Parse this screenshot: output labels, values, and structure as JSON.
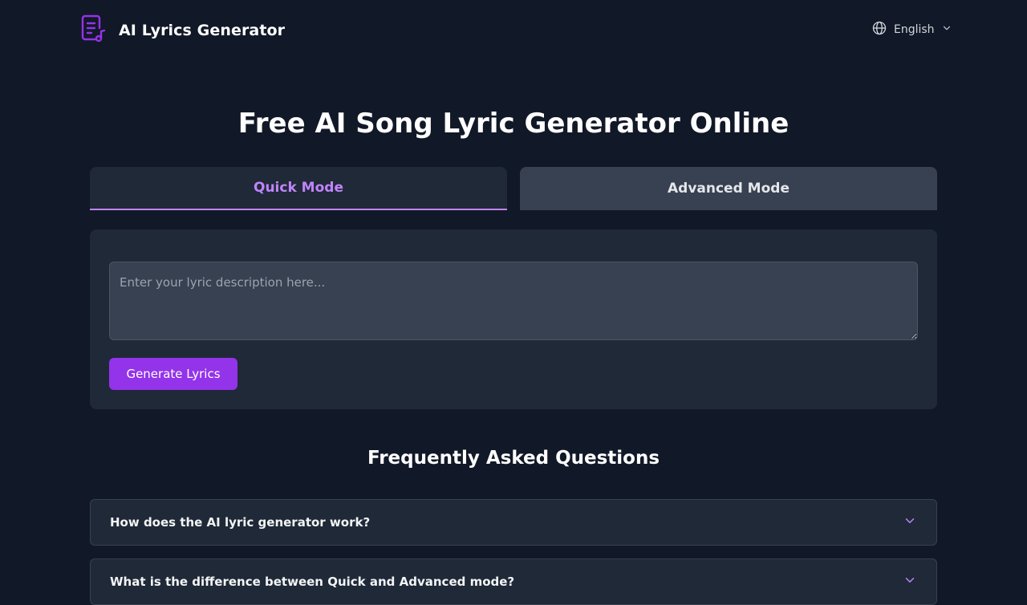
{
  "header": {
    "app_title": "AI Lyrics Generator",
    "language": "English",
    "logo_icon": "lyrics-document-music-icon",
    "accent_color": "#9333ea"
  },
  "main": {
    "title": "Free AI Song Lyric Generator Online",
    "tabs": [
      {
        "label": "Quick Mode",
        "active": true
      },
      {
        "label": "Advanced Mode",
        "active": false
      }
    ],
    "prompt": {
      "value": "",
      "placeholder": "Enter your lyric description here..."
    },
    "generate_label": "Generate Lyrics"
  },
  "faq": {
    "title": "Frequently Asked Questions",
    "items": [
      {
        "question": "How does the AI lyric generator work?"
      },
      {
        "question": "What is the difference between Quick and Advanced mode?"
      }
    ]
  }
}
